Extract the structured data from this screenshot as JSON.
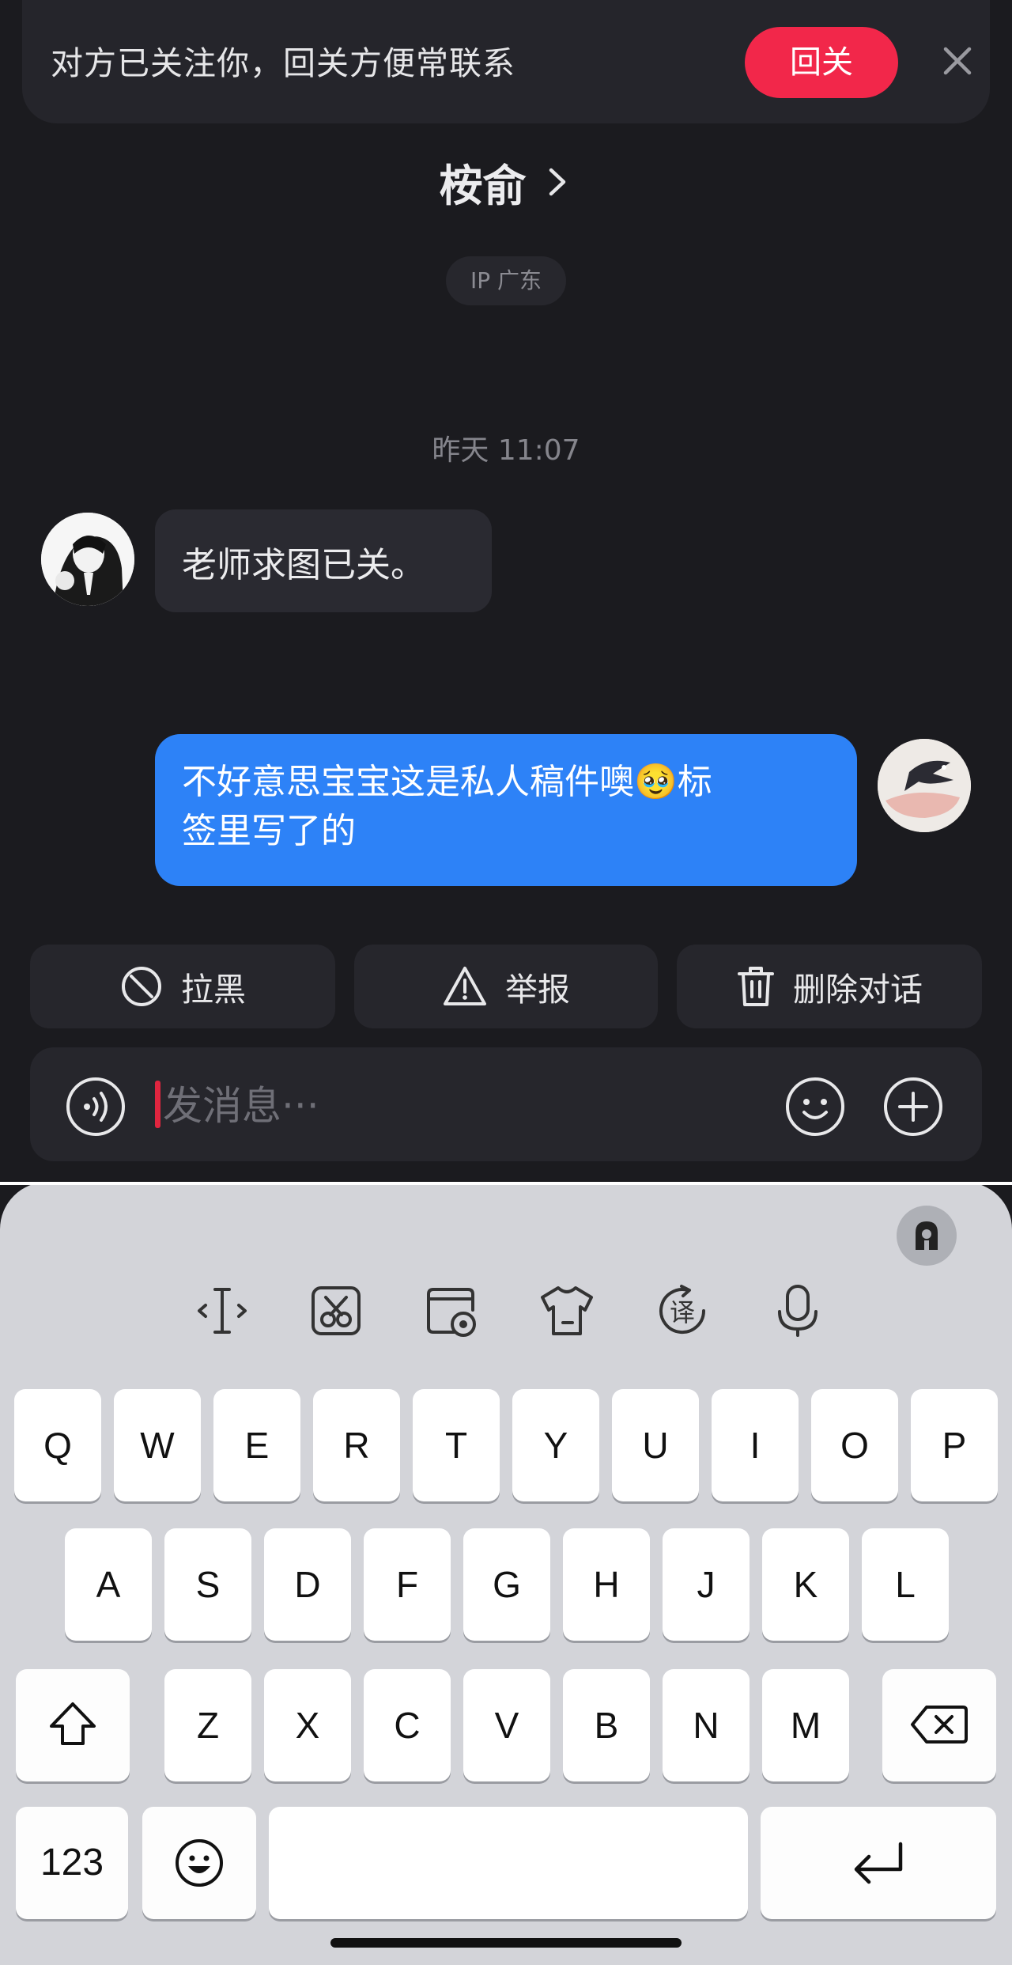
{
  "banner": {
    "text": "对方已关注你，回关方便常联系",
    "follow_back_label": "回关"
  },
  "header": {
    "contact_name": "桉俞",
    "ip_location": "IP 广东"
  },
  "messages": {
    "timestamp": "昨天 11:07",
    "incoming_text": "老师求图已关。",
    "outgoing_line1": "不好意思宝宝这是私人稿件噢🥹标",
    "outgoing_line2": "签里写了的"
  },
  "actions": {
    "block_label": "拉黑",
    "report_label": "举报",
    "delete_label": "删除对话"
  },
  "composer": {
    "placeholder": "发消息···"
  },
  "keyboard": {
    "row1": [
      "Q",
      "W",
      "E",
      "R",
      "T",
      "Y",
      "U",
      "I",
      "O",
      "P"
    ],
    "row2": [
      "A",
      "S",
      "D",
      "F",
      "G",
      "H",
      "J",
      "K",
      "L"
    ],
    "row3": [
      "Z",
      "X",
      "C",
      "V",
      "B",
      "N",
      "M"
    ],
    "numbers_label": "123",
    "toolbar_icons": [
      "cursor-move-icon",
      "clipboard-icon",
      "screenshot-icon",
      "skin-icon",
      "translate-icon",
      "microphone-icon"
    ]
  },
  "colors": {
    "background": "#1b1b1f",
    "accent_red": "#f2274a",
    "outgoing_bubble": "#2d82f7",
    "keyboard_bg": "#d3d4d9"
  }
}
